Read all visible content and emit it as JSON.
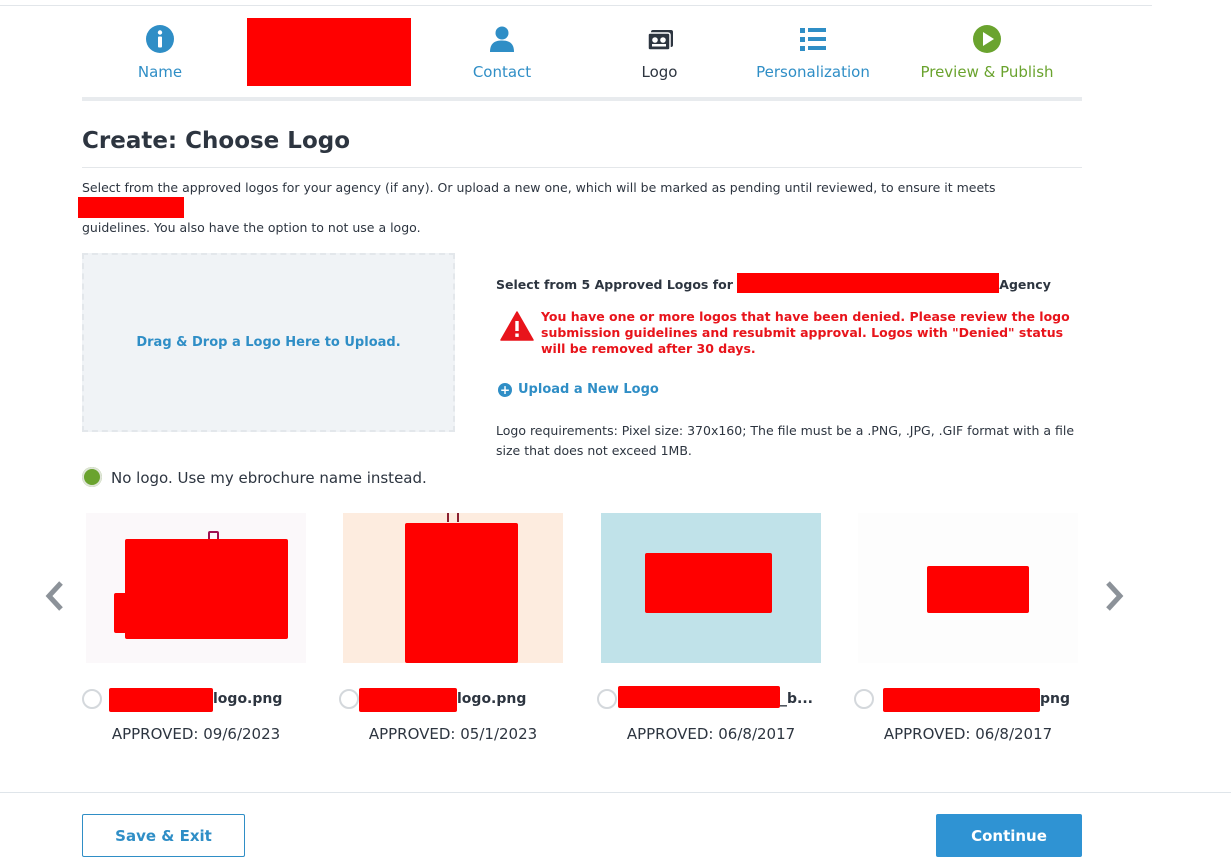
{
  "steps": [
    {
      "label": "Name",
      "icon": "info-icon"
    },
    {
      "label": "",
      "icon": "",
      "redacted": true
    },
    {
      "label": "Contact",
      "icon": "person-icon"
    },
    {
      "label": "Logo",
      "icon": "camera-icon",
      "active": true
    },
    {
      "label": "Personalization",
      "icon": "list-icon"
    },
    {
      "label": "Preview & Publish",
      "icon": "play-icon"
    }
  ],
  "page": {
    "title": "Create: Choose Logo",
    "intro_line1": "Select from the approved logos for your agency (if any). Or upload a new one, which will be marked as pending until reviewed, to ensure it meets",
    "intro_line2": "guidelines. You also have the option to not use a logo."
  },
  "upload": {
    "dropzone_text": "Drag & Drop a Logo Here to Upload.",
    "select_prefix": "Select from 5 Approved Logos for",
    "select_suffix": "Agency",
    "warning": "You have one or more logos that have been denied. Please review the logo submission guidelines and resubmit approval. Logos with \"Denied\" status will be removed after 30 days.",
    "upload_link": "Upload a New Logo",
    "requirements": "Logo requirements: Pixel size: 370x160; The file must be a .PNG, .JPG, .GIF format with a file size that does not exceed 1MB."
  },
  "no_logo": {
    "label": "No logo. Use my ebrochure name instead.",
    "selected": true
  },
  "logos": [
    {
      "filename": "logo.png",
      "status": "APPROVED: 09/6/2023",
      "bg": "#fbf8fa"
    },
    {
      "filename": "logo.png",
      "status": "APPROVED: 05/1/2023",
      "bg": "#fdecdf"
    },
    {
      "filename": "_b...",
      "status": "APPROVED: 06/8/2017",
      "bg": "#c0e2e9"
    },
    {
      "filename": "png",
      "status": "APPROVED: 06/8/2017",
      "bg": "#fdfdfd"
    }
  ],
  "footer": {
    "save_exit": "Save & Exit",
    "continue": "Continue"
  },
  "colors": {
    "accent": "#2f8ec6",
    "success": "#6aa32e",
    "danger": "#e8141b",
    "text": "#2d3540"
  }
}
